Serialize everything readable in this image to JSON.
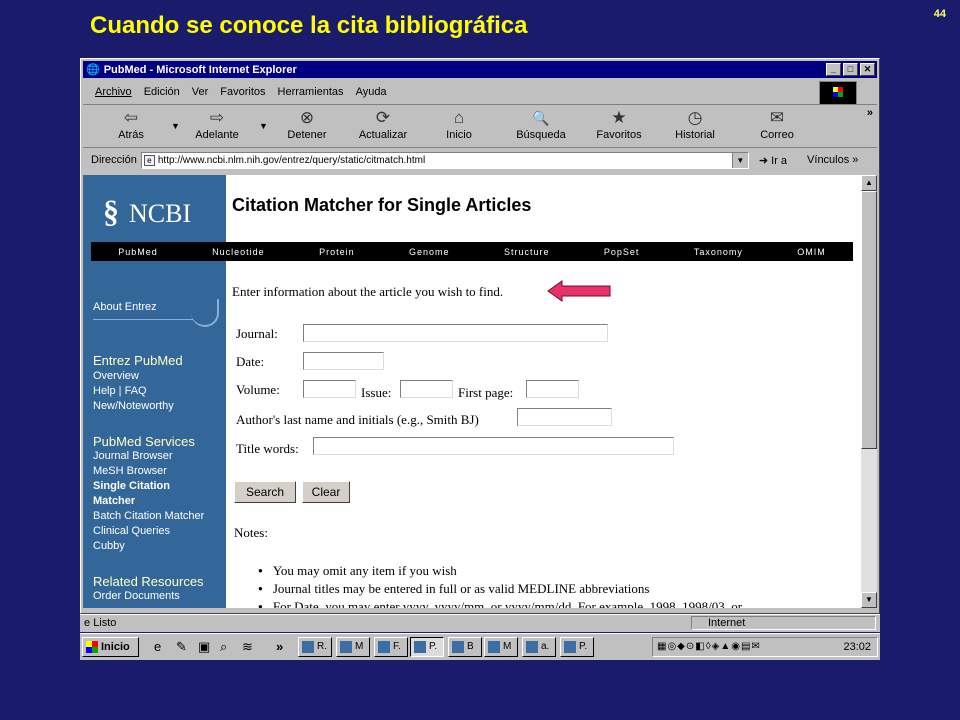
{
  "slide": {
    "title": "Cuando se conoce la cita bibliográfica",
    "page_number": "44"
  },
  "window": {
    "title": "PubMed - Microsoft Internet Explorer",
    "minimize": "_",
    "maximize": "□",
    "close": "✕"
  },
  "menu": {
    "items": [
      "Archivo",
      "Edición",
      "Ver",
      "Favoritos",
      "Herramientas",
      "Ayuda"
    ]
  },
  "toolbar": {
    "buttons": [
      {
        "label": "Atrás",
        "icon": "⇦"
      },
      {
        "label": "Adelante",
        "icon": "⇨"
      },
      {
        "label": "Detener",
        "icon": "⊗"
      },
      {
        "label": "Actualizar",
        "icon": "⟳"
      },
      {
        "label": "Inicio",
        "icon": "⌂"
      },
      {
        "label": "Búsqueda",
        "icon": "🔍"
      },
      {
        "label": "Favoritos",
        "icon": "★"
      },
      {
        "label": "Historial",
        "icon": "◷"
      },
      {
        "label": "Correo",
        "icon": "✉"
      }
    ],
    "more": "»"
  },
  "address": {
    "label": "Dirección",
    "url": "http://www.ncbi.nlm.nih.gov/entrez/query/static/citmatch.html",
    "go": "Ir a",
    "links": "Vínculos"
  },
  "ncbi": {
    "logo": "NCBI",
    "nav": [
      "PubMed",
      "Nucleotide",
      "Protein",
      "Genome",
      "Structure",
      "PopSet",
      "Taxonomy",
      "OMIM"
    ],
    "sidebar": {
      "about": "About Entrez",
      "entrez_head": "Entrez PubMed",
      "entrez_items": [
        "Overview",
        "Help | FAQ",
        "New/Noteworthy"
      ],
      "services_head": "PubMed Services",
      "services_items": [
        "Journal Browser",
        "MeSH Browser",
        "Single Citation",
        "Matcher",
        "Batch Citation Matcher",
        "Clinical Queries",
        "Cubby"
      ],
      "related_head": "Related Resources",
      "related_items": [
        "Order Documents"
      ]
    }
  },
  "page": {
    "heading": "Citation Matcher for Single Articles",
    "intro": "Enter information about the article you wish to find.",
    "labels": {
      "journal": "Journal:",
      "date": "Date:",
      "volume": "Volume:",
      "issue": "Issue:",
      "first_page": "First page:",
      "author": "Author's last name and initials (e.g., Smith BJ)",
      "title_words": "Title words:"
    },
    "buttons": {
      "search": "Search",
      "clear": "Clear"
    },
    "notes_head": "Notes:",
    "notes": [
      "You may omit any item if you wish",
      "Journal titles may be entered in full or as valid MEDLINE abbreviations",
      "For Date, you may enter yyyy, yyyy/mm, or yyyy/mm/dd. For example, 1998, 1998/03, or"
    ]
  },
  "status": {
    "left": "Listo",
    "zone": "Internet"
  },
  "taskbar": {
    "start": "Inicio",
    "tasks": [
      "R.",
      "M",
      "F.",
      "P.",
      "B",
      "M",
      "a.",
      "P."
    ],
    "clock": "23:02"
  },
  "colors": {
    "slide_bg": "#1b1b6b",
    "slide_title": "#ffff00",
    "ncbi_sidebar": "#336699",
    "arrow": "#e8336a"
  }
}
